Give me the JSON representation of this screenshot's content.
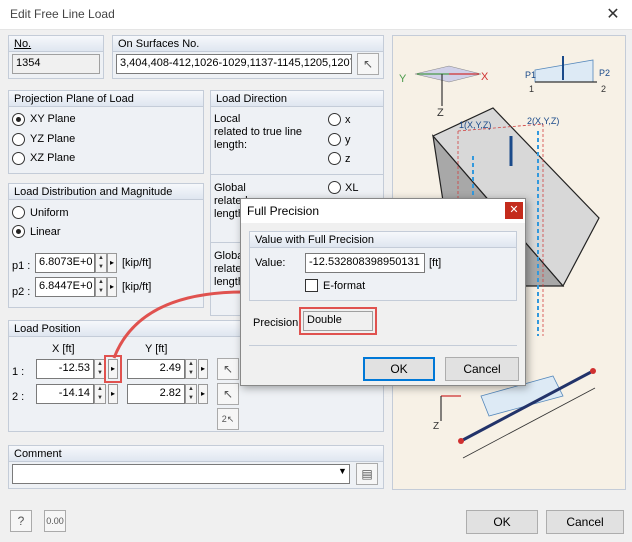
{
  "window": {
    "title": "Edit Free Line Load",
    "close_glyph": "✕"
  },
  "no": {
    "label": "No.",
    "value": "1354"
  },
  "surfaces": {
    "label": "On Surfaces No.",
    "value": "3,404,408-412,1026-1029,1137-1145,1205,1207"
  },
  "projection": {
    "header": "Projection Plane of Load",
    "options": [
      {
        "label": "XY Plane",
        "selected": true
      },
      {
        "label": "YZ Plane",
        "selected": false
      },
      {
        "label": "XZ Plane",
        "selected": false
      }
    ]
  },
  "direction": {
    "header": "Load Direction",
    "local_label": "Local\nrelated to true line\nlength:",
    "local_options": [
      "x",
      "y",
      "z"
    ],
    "global_label_1": "Global\nrelated",
    "global_label_1b": "length",
    "global_options": [
      "XL"
    ],
    "global_label_2": "Globa\nrelated\nlength"
  },
  "distribution": {
    "header": "Load Distribution and Magnitude",
    "options": [
      {
        "label": "Uniform",
        "selected": false
      },
      {
        "label": "Linear",
        "selected": true
      }
    ],
    "p1_label": "p1 :",
    "p1_value": "6.8073E+0",
    "p1_unit": "[kip/ft]",
    "p2_label": "p2 :",
    "p2_value": "6.8447E+0",
    "p2_unit": "[kip/ft]"
  },
  "position": {
    "header": "Load Position",
    "x_header": "X  [ft]",
    "y_header": "Y  [ft]",
    "rows": [
      {
        "label": "1 :",
        "x": "-12.53",
        "y": "2.49"
      },
      {
        "label": "2 :",
        "x": "-14.14",
        "y": "2.82"
      }
    ]
  },
  "comment": {
    "label": "Comment",
    "value": ""
  },
  "buttons": {
    "ok": "OK",
    "cancel": "Cancel"
  },
  "precision_dialog": {
    "title": "Full Precision",
    "group_header": "Value with Full Precision",
    "value_label": "Value:",
    "value": "-12.532808398950131",
    "unit": "[ft]",
    "eformat_label": "E-format",
    "precision_label": "Precision:",
    "precision_value": "Double",
    "ok": "OK",
    "cancel": "Cancel"
  },
  "diagram": {
    "axis_y": "Y",
    "axis_x": "X",
    "axis_z": "Z",
    "p1": "P1",
    "p2": "P2",
    "n1": "1",
    "n2": "2",
    "pt1": "1(X,Y,Z)",
    "pt2": "2(X,Y,Z)"
  },
  "icons": {
    "help": "help-icon",
    "units": "units-icon",
    "pick": "pick-cursor-icon"
  },
  "colors": {
    "accent": "#0078d7",
    "highlight": "#e0524f",
    "group_bg": "#eef1f5"
  }
}
